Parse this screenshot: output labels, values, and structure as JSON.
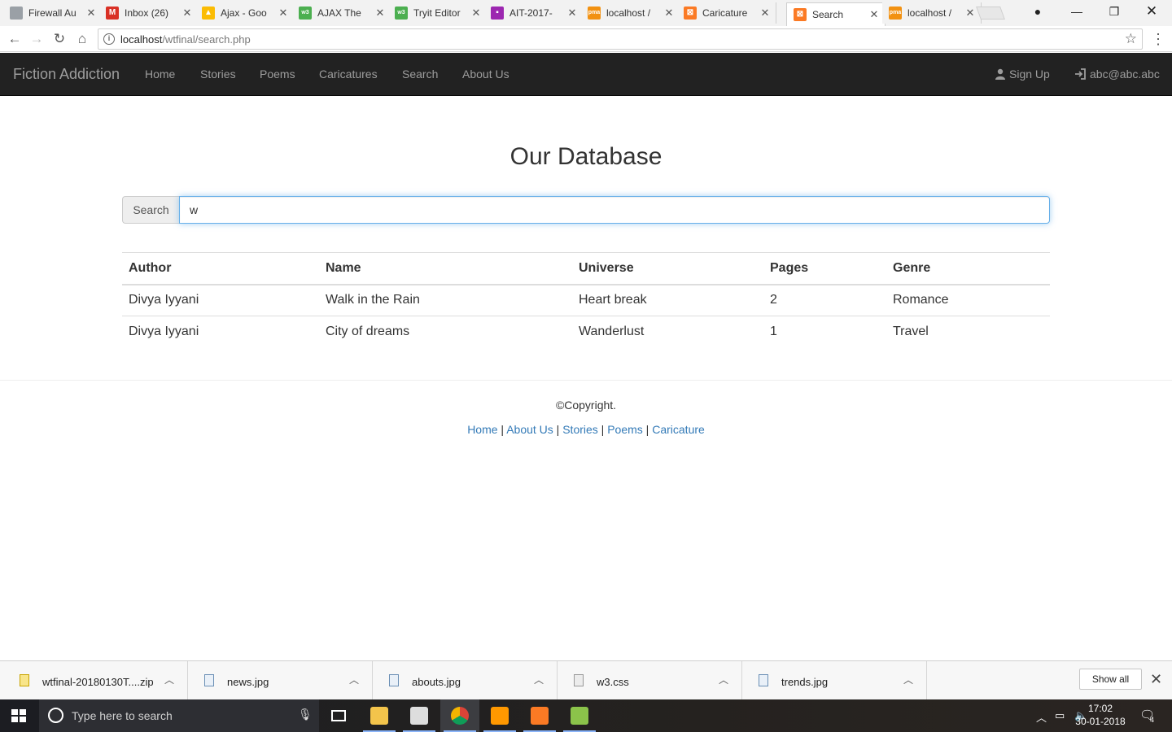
{
  "browser": {
    "tabs": [
      {
        "title": "Firewall Au",
        "favicon_color": "#9aa0a6",
        "favicon_glyph": ""
      },
      {
        "title": "Inbox (26)",
        "favicon_color": "#d93025",
        "favicon_glyph": "M"
      },
      {
        "title": "Ajax - Goo",
        "favicon_color": "#fbbc04",
        "favicon_glyph": "▲"
      },
      {
        "title": "AJAX The",
        "favicon_color": "#4caf50",
        "favicon_glyph": "w3"
      },
      {
        "title": "Tryit Editor",
        "favicon_color": "#4caf50",
        "favicon_glyph": "w3"
      },
      {
        "title": "AIT-2017-",
        "favicon_color": "#9c27b0",
        "favicon_glyph": "▪"
      },
      {
        "title": "localhost /",
        "favicon_color": "#f29111",
        "favicon_glyph": "pma"
      },
      {
        "title": "Caricature",
        "favicon_color": "#fb7a24",
        "favicon_glyph": "⊠"
      },
      {
        "title": "Search",
        "favicon_color": "#fb7a24",
        "favicon_glyph": "⊠"
      },
      {
        "title": "localhost /",
        "favicon_color": "#f29111",
        "favicon_glyph": "pma"
      }
    ],
    "active_tab_index": 8,
    "url_host": "localhost",
    "url_path": "/wtfinal/search.php"
  },
  "navbar": {
    "brand": "Fiction Addiction",
    "links": [
      "Home",
      "Stories",
      "Poems",
      "Caricatures",
      "Search",
      "About Us"
    ],
    "signup_label": "Sign Up",
    "user_label": "abc@abc.abc"
  },
  "main": {
    "heading": "Our Database",
    "search_addon": "Search",
    "search_value": "w",
    "columns": [
      "Author",
      "Name",
      "Universe",
      "Pages",
      "Genre"
    ],
    "rows": [
      [
        "Divya Iyyani",
        "Walk in the Rain",
        "Heart break",
        "2",
        "Romance"
      ],
      [
        "Divya Iyyani",
        "City of dreams",
        "Wanderlust",
        "1",
        "Travel"
      ]
    ]
  },
  "footer": {
    "copyright": "©Copyright.",
    "links": [
      "Home",
      "About Us",
      "Stories",
      "Poems",
      "Caricature"
    ],
    "separator": " | "
  },
  "downloads": {
    "items": [
      {
        "name": "wtfinal-20180130T....zip",
        "icon": "zip-file-icon"
      },
      {
        "name": "news.jpg",
        "icon": "image-file-icon"
      },
      {
        "name": "abouts.jpg",
        "icon": "image-file-icon"
      },
      {
        "name": "w3.css",
        "icon": "css-file-icon"
      },
      {
        "name": "trends.jpg",
        "icon": "image-file-icon"
      }
    ],
    "show_all_label": "Show all"
  },
  "taskbar": {
    "search_placeholder": "Type here to search",
    "time": "17:02",
    "date": "30-01-2018",
    "notification_count": "4"
  },
  "colors": {
    "navbar_bg": "#222222",
    "navbar_text": "#9d9d9d",
    "link": "#337ab7",
    "focus_border": "#66afe9"
  }
}
